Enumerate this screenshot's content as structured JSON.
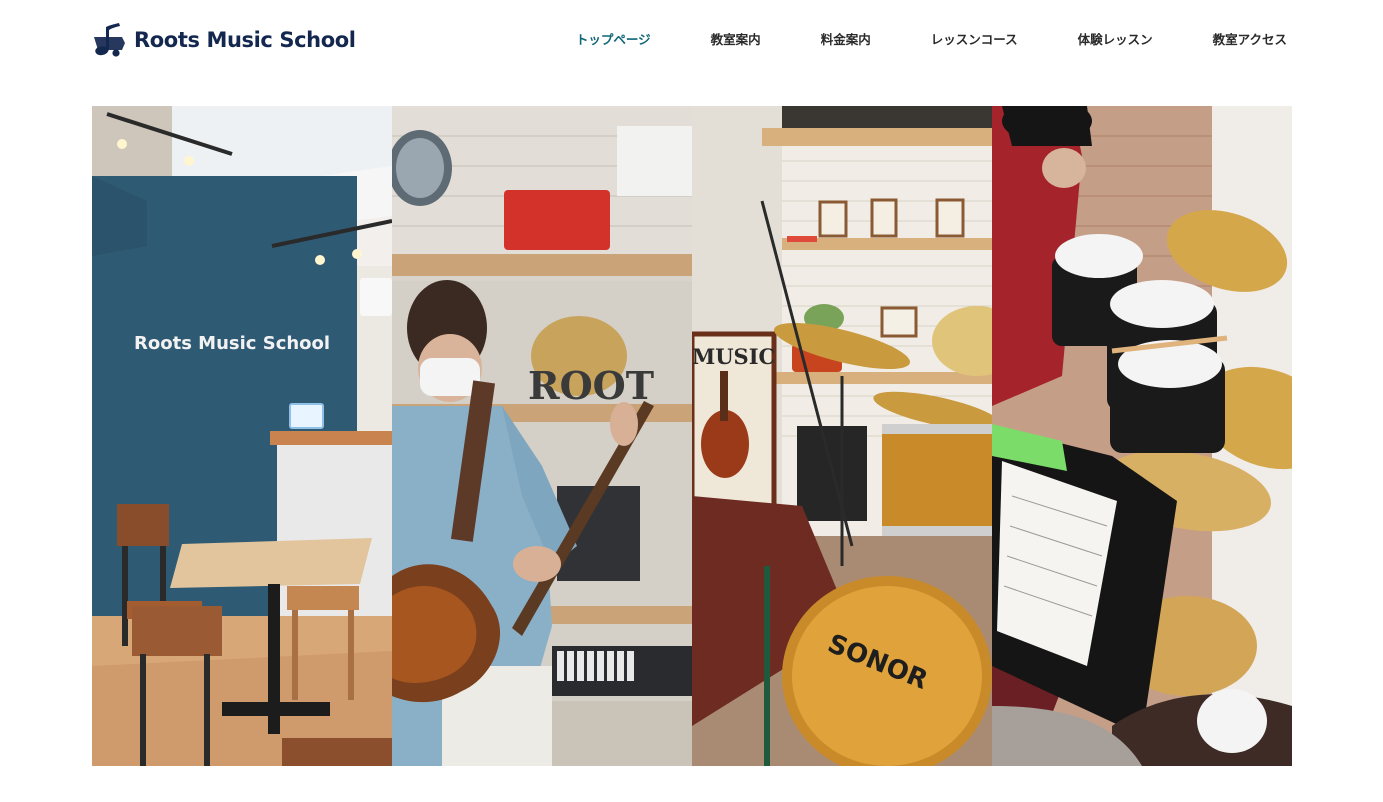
{
  "header": {
    "logo_text": "Roots Music School",
    "logo_icon": "music-note-icon"
  },
  "nav": {
    "items": [
      {
        "label": "トップページ",
        "active": true
      },
      {
        "label": "教室案内",
        "active": false
      },
      {
        "label": "料金案内",
        "active": false
      },
      {
        "label": "レッスンコース",
        "active": false
      },
      {
        "label": "体験レッスン",
        "active": false
      },
      {
        "label": "教室アクセス",
        "active": false
      }
    ]
  },
  "gallery": {
    "panels": [
      {
        "scene": "reception-lounge",
        "wall_sign": "Roots Music School"
      },
      {
        "scene": "guitar-player",
        "background_text": "ROOT"
      },
      {
        "scene": "drum-studio",
        "poster_text": "MUSIC",
        "drum_brand": "SONOR"
      },
      {
        "scene": "drum-lesson"
      }
    ]
  },
  "colors": {
    "brand_navy": "#13274f",
    "nav_active": "#0f6676",
    "nav_text": "#2a2a2a",
    "wall_blue": "#2f5a74"
  }
}
